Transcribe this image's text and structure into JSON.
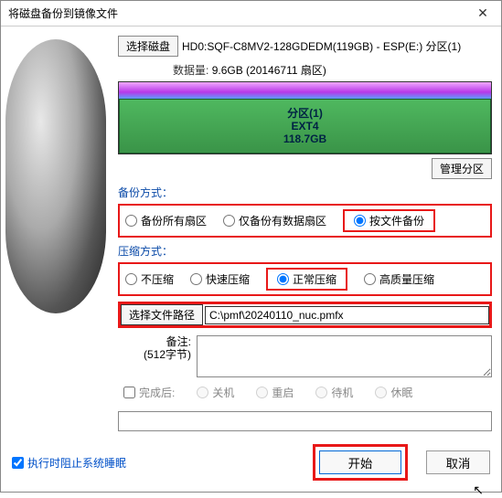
{
  "window": {
    "title": "将磁盘备份到镜像文件"
  },
  "disk": {
    "select_btn": "选择磁盘",
    "label": "HD0:SQF-C8MV2-128GDEDM(119GB) - ESP(E:) 分区(1)",
    "data_label": "数据量:",
    "data_value": "9.6GB (20146711 扇区)"
  },
  "partition": {
    "name": "分区(1)",
    "fs": "EXT4",
    "size": "118.7GB",
    "manage_btn": "管理分区"
  },
  "backup": {
    "label": "备份方式：",
    "opt_all": "备份所有扇区",
    "opt_data": "仅备份有数据扇区",
    "opt_file": "按文件备份"
  },
  "compress": {
    "label": "压缩方式：",
    "opt_none": "不压缩",
    "opt_fast": "快速压缩",
    "opt_normal": "正常压缩",
    "opt_high": "高质量压缩"
  },
  "filepath": {
    "btn": "选择文件路径",
    "value": "C:\\pmf\\20240110_nuc.pmfx"
  },
  "remark": {
    "label1": "备注:",
    "label2": "(512字节)"
  },
  "after": {
    "label": "完成后:",
    "opt_shutdown": "关机",
    "opt_restart": "重启",
    "opt_standby": "待机",
    "opt_hibernate": "休眠"
  },
  "footer": {
    "sleep_chk": "执行时阻止系统睡眠",
    "start": "开始",
    "cancel": "取消"
  }
}
